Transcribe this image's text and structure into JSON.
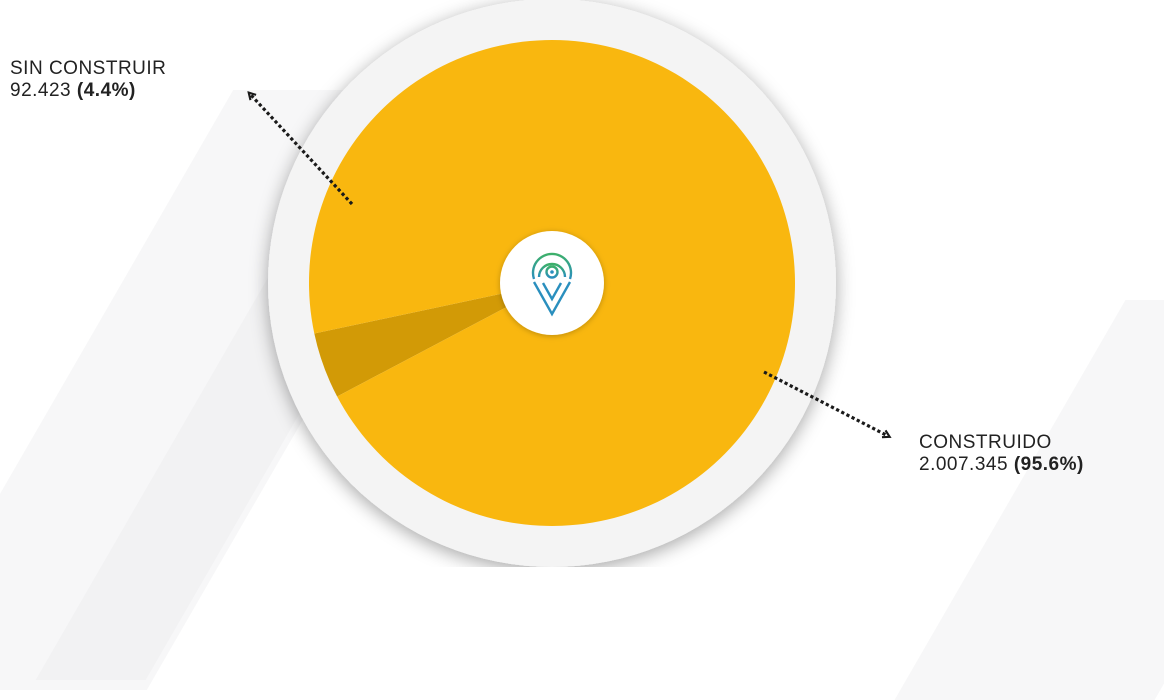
{
  "chart_data": {
    "type": "pie",
    "slices": [
      {
        "label": "CONSTRUIDO",
        "value": 2007345,
        "value_text": "2.007.345",
        "pct_text": "(95.6%)",
        "color": "#f9b70f"
      },
      {
        "label": "SIN CONSTRUIR",
        "value": 92423,
        "value_text": "92.423",
        "pct_text": "(4.4%)",
        "color": "#d29a06"
      }
    ]
  },
  "colors": {
    "ring": "#f4f4f4",
    "center": "#ffffff",
    "logo_green": "#3db06a",
    "logo_blue": "#2a8fbe",
    "arrow": "#1a1a1a"
  },
  "icons": {
    "center_logo": "location-pin-logo-icon"
  }
}
